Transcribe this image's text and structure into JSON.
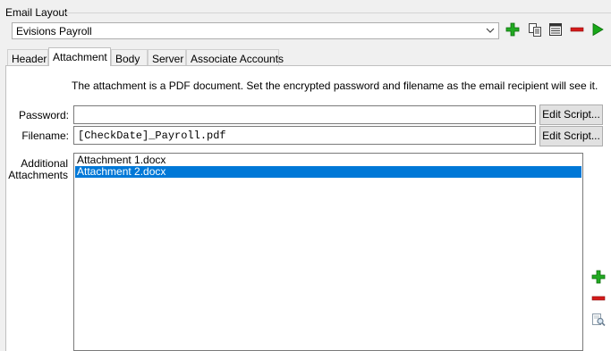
{
  "group": {
    "title": "Email Layout"
  },
  "layout_select": {
    "value": "Evisions Payroll"
  },
  "toolbar": {
    "icons": [
      "add-icon",
      "copy-icon",
      "list-icon",
      "remove-icon",
      "run-icon"
    ],
    "colors": {
      "add": "#22aa22",
      "remove": "#d41a1a",
      "run": "#18a818"
    }
  },
  "tabs": [
    {
      "label": "Header",
      "active": false
    },
    {
      "label": "Attachment",
      "active": true
    },
    {
      "label": "Body",
      "active": false
    },
    {
      "label": "Server",
      "active": false
    },
    {
      "label": "Associate Accounts",
      "active": false
    }
  ],
  "attachment": {
    "info": "The attachment is a PDF document.  Set the encrypted password and filename as the email recipient will see it.",
    "password": {
      "label": "Password:",
      "value": "",
      "button": "Edit Script..."
    },
    "filename": {
      "label": "Filename:",
      "value": "[CheckDate]_Payroll.pdf",
      "button": "Edit Script..."
    },
    "additional": {
      "label_line1": "Additional",
      "label_line2": "Attachments",
      "items": [
        {
          "name": "Attachment 1.docx",
          "selected": false
        },
        {
          "name": "Attachment 2.docx",
          "selected": true
        }
      ],
      "side_icons": [
        "add-icon",
        "remove-icon",
        "preview-icon"
      ]
    }
  },
  "colors": {
    "selection": "#0078d7",
    "panel": "#ffffff",
    "window": "#f0f0f0"
  }
}
